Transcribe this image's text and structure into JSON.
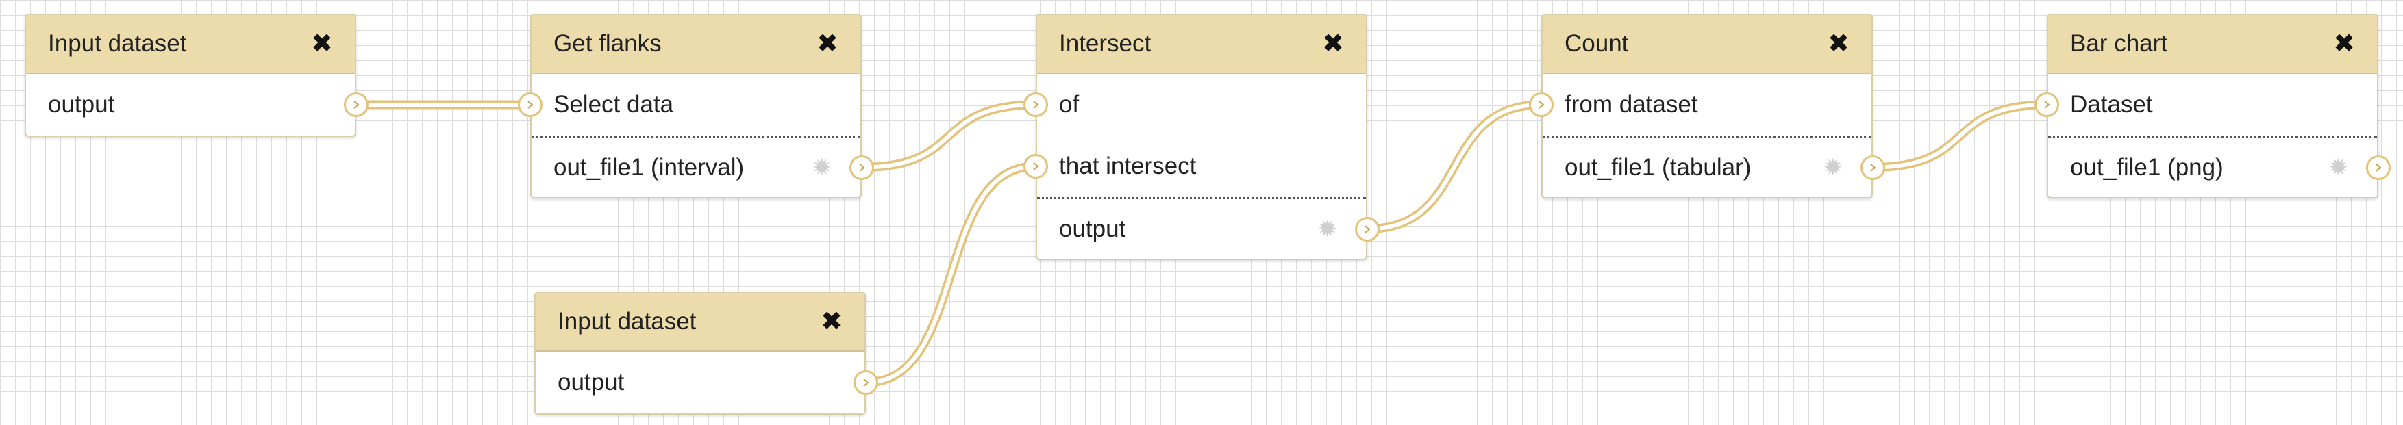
{
  "nodes": {
    "input1": {
      "title": "Input dataset",
      "rows": [
        "output"
      ]
    },
    "flanks": {
      "title": "Get flanks",
      "rows": [
        "Select data",
        "out_file1 (interval)"
      ]
    },
    "input2": {
      "title": "Input dataset",
      "rows": [
        "output"
      ]
    },
    "intersect": {
      "title": "Intersect",
      "rows": [
        "of",
        "that intersect",
        "output"
      ]
    },
    "count": {
      "title": "Count",
      "rows": [
        "from dataset",
        "out_file1 (tabular)"
      ]
    },
    "barchart": {
      "title": "Bar chart",
      "rows": [
        "Dataset",
        "out_file1 (png)"
      ]
    }
  },
  "icons": {
    "close": "close-icon",
    "output_settings": "gear-icon",
    "terminal": "chevron-right-icon"
  },
  "colors": {
    "header": "#ecdcab",
    "border": "#d9cfa8",
    "wire": "#e3c27a",
    "grid": "#dcdcdc"
  }
}
